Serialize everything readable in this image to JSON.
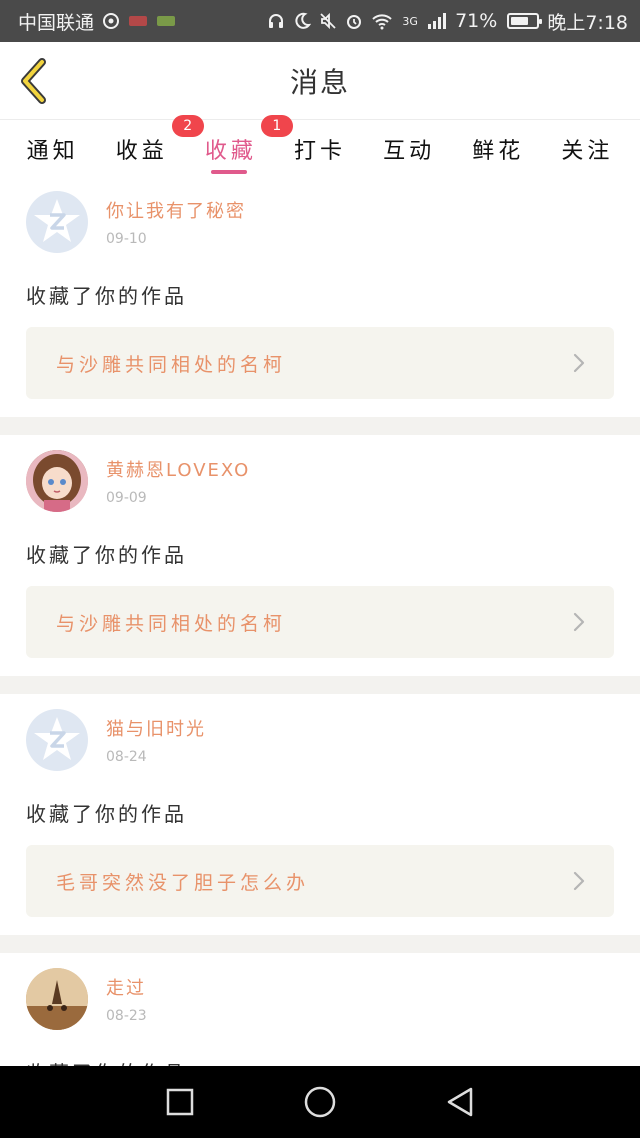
{
  "status_bar": {
    "carrier": "中国联通",
    "network": "3G",
    "battery": "71%",
    "battery_level": 0.71,
    "time": "晚上7:18"
  },
  "header": {
    "title": "消息"
  },
  "tabs": [
    {
      "label": "通知",
      "badge": "",
      "active": false
    },
    {
      "label": "收益",
      "badge": "2",
      "active": false
    },
    {
      "label": "收藏",
      "badge": "1",
      "active": true
    },
    {
      "label": "打卡",
      "badge": "",
      "active": false
    },
    {
      "label": "互动",
      "badge": "",
      "active": false
    },
    {
      "label": "鲜花",
      "badge": "",
      "active": false
    },
    {
      "label": "关注",
      "badge": "",
      "active": false
    }
  ],
  "items": [
    {
      "nickname": "你让我有了秘密",
      "date": "09-10",
      "action": "收藏了你的作品",
      "work_title": "与沙雕共同相处的名柯",
      "avatar": "qq-default"
    },
    {
      "nickname": "黄赫恩LOVEXO",
      "date": "09-09",
      "action": "收藏了你的作品",
      "work_title": "与沙雕共同相处的名柯",
      "avatar": "anime-girl"
    },
    {
      "nickname": "猫与旧时光",
      "date": "08-24",
      "action": "收藏了你的作品",
      "work_title": "毛哥突然没了胆子怎么办",
      "avatar": "qq-default"
    },
    {
      "nickname": "走过",
      "date": "08-23",
      "action": "收藏了你的作品",
      "work_title": "",
      "avatar": "scene"
    }
  ],
  "colors": {
    "accent_pink": "#e05a8c",
    "accent_orange": "#e8926a",
    "badge_red": "#f0454c"
  }
}
